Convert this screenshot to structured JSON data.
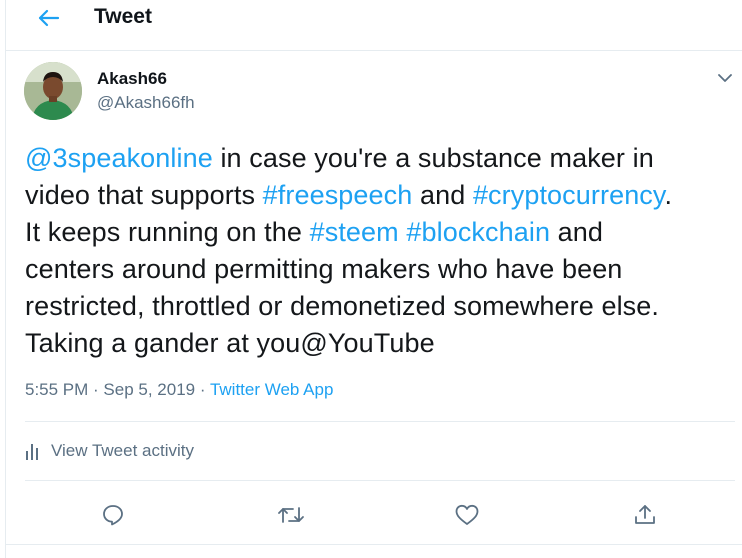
{
  "header": {
    "title": "Tweet"
  },
  "user": {
    "name": "Akash66",
    "handle": "@Akash66fh"
  },
  "tweet": {
    "lines": [
      [
        {
          "t": "@3speakonline",
          "link": true
        },
        {
          "t": " in case you're a substance maker in",
          "link": false
        }
      ],
      [
        {
          "t": "video that supports ",
          "link": false
        },
        {
          "t": "#freespeech",
          "link": true
        },
        {
          "t": " and ",
          "link": false
        },
        {
          "t": "#cryptocurrency",
          "link": true
        },
        {
          "t": ".",
          "link": false
        }
      ],
      [
        {
          "t": "It keeps running on the ",
          "link": false
        },
        {
          "t": "#steem",
          "link": true
        },
        {
          "t": " ",
          "link": false
        },
        {
          "t": "#blockchain",
          "link": true
        },
        {
          "t": " and",
          "link": false
        }
      ],
      [
        {
          "t": "centers around permitting makers who have been",
          "link": false
        }
      ],
      [
        {
          "t": "restricted, throttled or demonetized somewhere else.",
          "link": false
        }
      ],
      [
        {
          "t": "Taking a gander at you@YouTube",
          "link": false
        }
      ]
    ]
  },
  "meta": {
    "time": "5:55 PM",
    "sep1": " · ",
    "date": "Sep 5, 2019",
    "sep2": " · ",
    "app": "Twitter Web App"
  },
  "activity": {
    "label": "View Tweet activity"
  },
  "icons": {
    "back": "back-arrow-icon",
    "caret": "chevron-down-icon",
    "activity": "bar-chart-icon",
    "reply": "reply-icon",
    "retweet": "retweet-icon",
    "like": "heart-icon",
    "share": "share-icon"
  },
  "colors": {
    "accent": "#1da1f2",
    "secondary_text": "#5b7083",
    "border": "#e6ecf0"
  }
}
